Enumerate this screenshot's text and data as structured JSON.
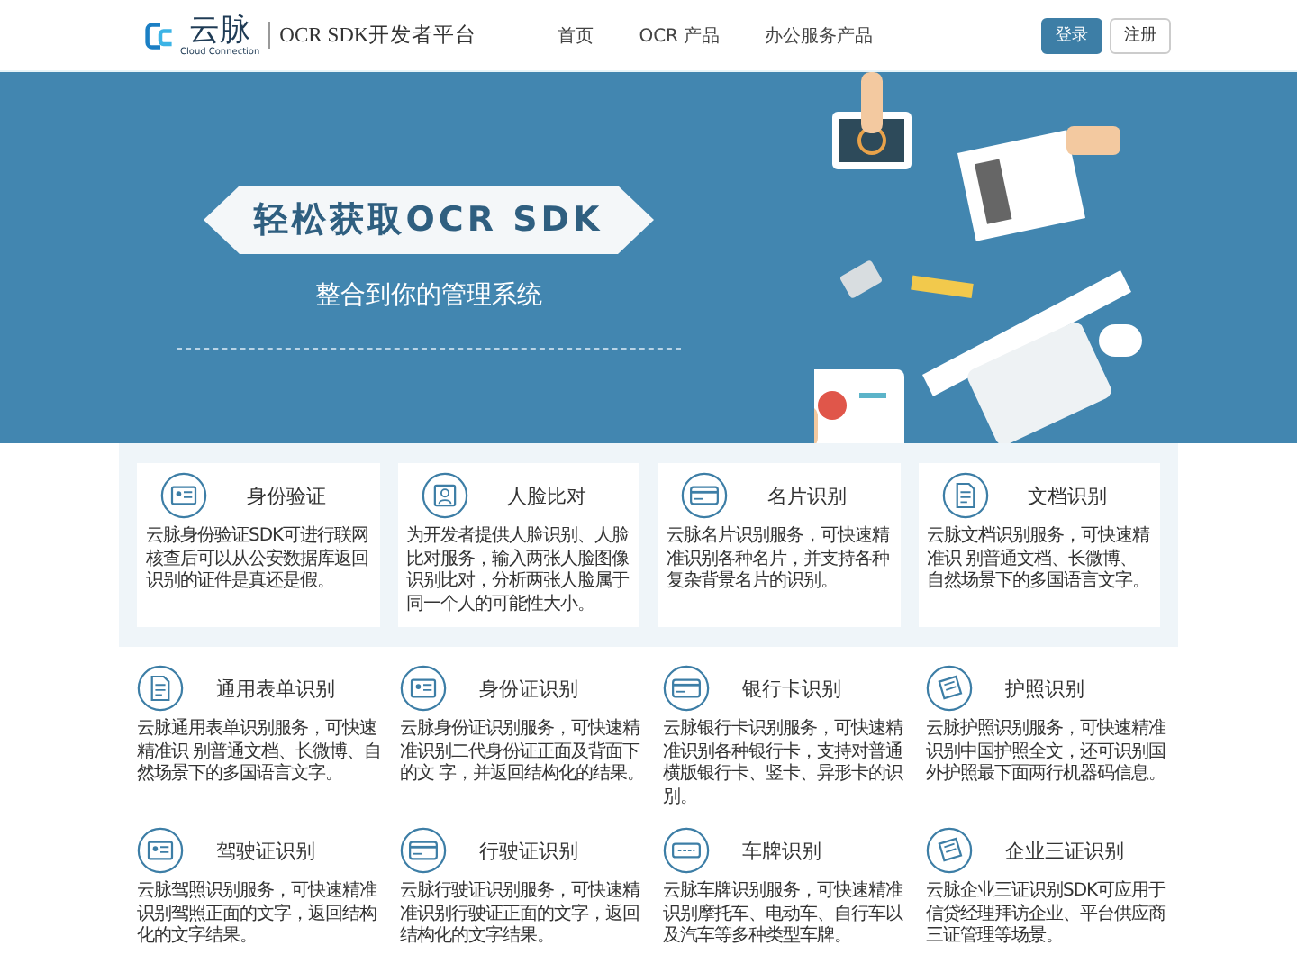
{
  "header": {
    "logo": {
      "name": "云脉",
      "tagline": "Cloud Connection"
    },
    "site_title": "OCR SDK开发者平台",
    "nav": [
      {
        "label": "首页",
        "selected": false
      },
      {
        "label": "OCR 产品",
        "selected": false
      },
      {
        "label": "办公服务产品",
        "selected": false
      }
    ],
    "buttons": [
      {
        "label": "登录",
        "kind": "primary"
      },
      {
        "label": "注册",
        "kind": "secondary"
      }
    ]
  },
  "banner": {
    "title": "轻松获取OCR SDK",
    "subtitle": "整合到你的管理系统"
  },
  "featured": [
    {
      "kind": "id-card",
      "title": "身份验证",
      "description": "云脉身份验证SDK可进行联网核查后可以从公安数据库返回识别的证件是真还是假。"
    },
    {
      "kind": "person",
      "title": "人脸比对",
      "description": "为开发者提供人脸识别、人脸比对服务，输入两张人脸图像识别比对，分析两张人脸属于同一个人的可能性大小。"
    },
    {
      "kind": "card",
      "title": "名片识别",
      "description": "云脉名片识别服务，可快速精准识别各种名片，并支持各种复杂背景名片的识别。"
    },
    {
      "kind": "document",
      "title": "文档识别",
      "description": "云脉文档识别服务，可快速精准识 别普通文档、长微博、自然场景下的多国语言文字。"
    }
  ],
  "products": [
    {
      "kind": "document",
      "title": "通用表单识别",
      "description": "云脉通用表单识别服务，可快速精准识 别普通文档、长微博、自然场景下的多国语言文字。"
    },
    {
      "kind": "id-card",
      "title": "身份证识别",
      "description": "云脉身份证识别服务，可快速精准识别二代身份证正面及背面下的文 字，并返回结构化的结果。"
    },
    {
      "kind": "card",
      "title": "银行卡识别",
      "description": "云脉银行卡识别服务，可快速精准识别各种银行卡，支持对普通横版银行卡、竖卡、异形卡的识别。"
    },
    {
      "kind": "passport",
      "title": "护照识别",
      "description": "云脉护照识别服务，可快速精准识别中国护照全文，还可识别国外护照最下面两行机器码信息。"
    },
    {
      "kind": "id-card",
      "title": "驾驶证识别",
      "description": "云脉驾照识别服务，可快速精准识别驾照正面的文字，返回结构化的文字结果。"
    },
    {
      "kind": "card",
      "title": "行驶证识别",
      "description": "云脉行驶证识别服务，可快速精准识别行驶证正面的文字，返回结构化的文字结果。"
    },
    {
      "kind": "plate",
      "title": "车牌识别",
      "description": "云脉车牌识别服务，可快速精准识别摩托车、电动车、自行车以及汽车等多种类型车牌。"
    },
    {
      "kind": "passport",
      "title": "企业三证识别",
      "description": "云脉企业三证识别SDK可应用于信贷经理拜访企业、平台供应商三证管理等场景。"
    }
  ]
}
